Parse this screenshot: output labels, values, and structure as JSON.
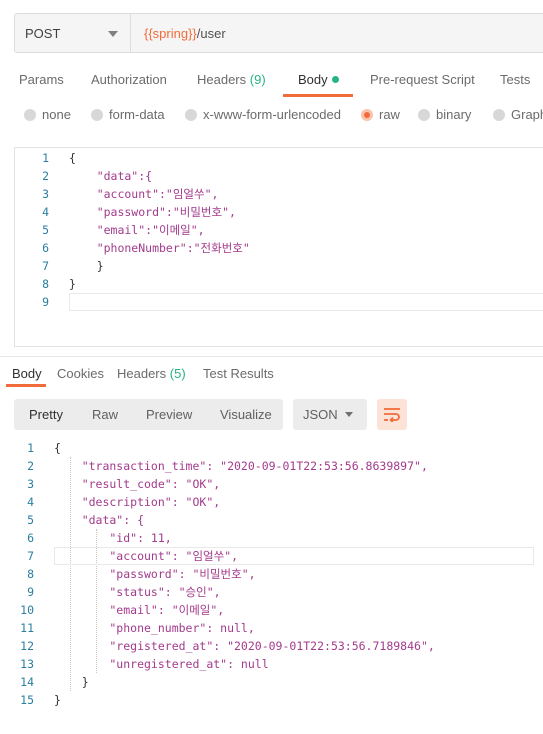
{
  "request": {
    "method": "POST",
    "url_variable": "{{spring}}",
    "url_path": "/user"
  },
  "request_tabs": [
    {
      "label": "Params",
      "count": ""
    },
    {
      "label": "Authorization",
      "count": ""
    },
    {
      "label": "Headers",
      "count": "(9)"
    },
    {
      "label": "Body",
      "count": ""
    },
    {
      "label": "Pre-request Script",
      "count": ""
    },
    {
      "label": "Tests",
      "count": ""
    }
  ],
  "active_request_tab": "Body",
  "body_types": [
    {
      "label": "none",
      "checked": false
    },
    {
      "label": "form-data",
      "checked": false
    },
    {
      "label": "x-www-form-urlencoded",
      "checked": false
    },
    {
      "label": "raw",
      "checked": true
    },
    {
      "label": "binary",
      "checked": false
    },
    {
      "label": "Graph",
      "checked": false
    }
  ],
  "request_body_lines": [
    {
      "n": "1",
      "text": "{"
    },
    {
      "n": "2",
      "text": "    \"data\":{"
    },
    {
      "n": "3",
      "text": "    \"account\":\"임얼쑤\","
    },
    {
      "n": "4",
      "text": "    \"password\":\"비밀번호\","
    },
    {
      "n": "5",
      "text": "    \"email\":\"이메일\","
    },
    {
      "n": "6",
      "text": "    \"phoneNumber\":\"전화번호\""
    },
    {
      "n": "7",
      "text": "    }"
    },
    {
      "n": "8",
      "text": "}"
    },
    {
      "n": "9",
      "text": ""
    }
  ],
  "response_tabs": [
    {
      "label": "Body",
      "count": ""
    },
    {
      "label": "Cookies",
      "count": ""
    },
    {
      "label": "Headers",
      "count": "(5)"
    },
    {
      "label": "Test Results",
      "count": ""
    }
  ],
  "active_response_tab": "Body",
  "view_modes": [
    "Pretty",
    "Raw",
    "Preview",
    "Visualize"
  ],
  "active_view_mode": "Pretty",
  "format": "JSON",
  "response_body_lines": [
    {
      "n": "1",
      "text": "{"
    },
    {
      "n": "2",
      "text": "    \"transaction_time\": \"2020-09-01T22:53:56.8639897\","
    },
    {
      "n": "3",
      "text": "    \"result_code\": \"OK\","
    },
    {
      "n": "4",
      "text": "    \"description\": \"OK\","
    },
    {
      "n": "5",
      "text": "    \"data\": {"
    },
    {
      "n": "6",
      "text": "        \"id\": 11,"
    },
    {
      "n": "7",
      "text": "        \"account\": \"임얼쑤\","
    },
    {
      "n": "8",
      "text": "        \"password\": \"비밀번호\","
    },
    {
      "n": "9",
      "text": "        \"status\": \"승인\","
    },
    {
      "n": "10",
      "text": "        \"email\": \"이메일\","
    },
    {
      "n": "11",
      "text": "        \"phone_number\": null,"
    },
    {
      "n": "12",
      "text": "        \"registered_at\": \"2020-09-01T22:53:56.7189846\","
    },
    {
      "n": "13",
      "text": "        \"unregistered_at\": null"
    },
    {
      "n": "14",
      "text": "    }"
    },
    {
      "n": "15",
      "text": "}"
    }
  ],
  "colors": {
    "accent": "#f26b3a",
    "count_green": "#26b47f",
    "line_number": "#2a7fa0",
    "json_key": "#a33b8c",
    "json_string": "#3a3aa6",
    "json_number": "#1c7a3c"
  },
  "icons": {
    "method_dropdown": "chevron-down-icon",
    "format_dropdown": "chevron-down-icon",
    "wrap_lines": "wrap-lines-icon",
    "body_indicator": "dot-icon"
  }
}
